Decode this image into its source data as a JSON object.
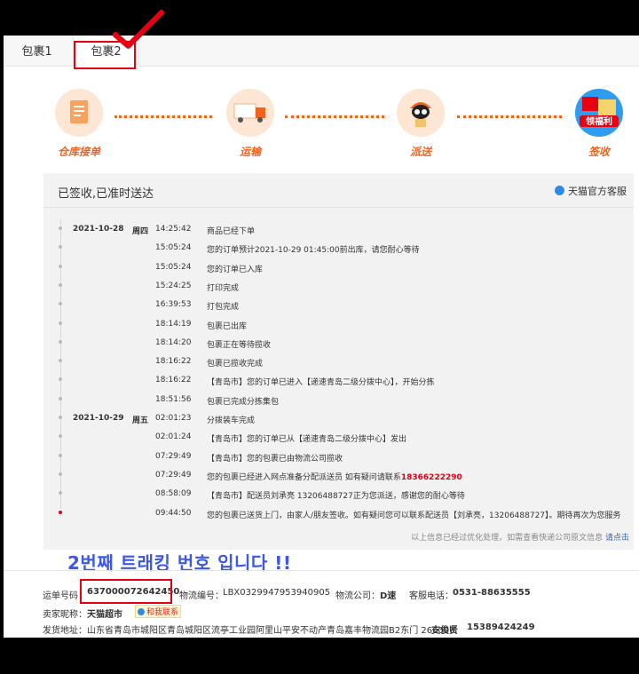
{
  "tabs": [
    {
      "label": "包裹1"
    },
    {
      "label": "包裹2"
    }
  ],
  "steps": [
    {
      "label": "仓库接单",
      "icon": "warehouse-icon"
    },
    {
      "label": "运输",
      "icon": "truck-icon"
    },
    {
      "label": "派送",
      "icon": "courier-icon"
    },
    {
      "label": "签收",
      "icon": "gift-icon",
      "badge": "领福利"
    }
  ],
  "tracking": {
    "status": "已签收,已准时送达",
    "service": "天猫官方客服",
    "footer_note": "以上信息已经过优化处理，如需查看快递公司原文信息",
    "footer_link": "请点击",
    "events": [
      {
        "date": "2021-10-28",
        "weekday": "周四",
        "time": "14:25:42",
        "desc": "商品已经下单"
      },
      {
        "date": "",
        "weekday": "",
        "time": "15:05:24",
        "desc": "您的订单预计2021-10-29 01:45:00前出库，请您耐心等待"
      },
      {
        "date": "",
        "weekday": "",
        "time": "15:05:24",
        "desc": "您的订单已入库"
      },
      {
        "date": "",
        "weekday": "",
        "time": "15:24:25",
        "desc": "打印完成"
      },
      {
        "date": "",
        "weekday": "",
        "time": "16:39:53",
        "desc": "打包完成"
      },
      {
        "date": "",
        "weekday": "",
        "time": "18:14:19",
        "desc": "包裹已出库"
      },
      {
        "date": "",
        "weekday": "",
        "time": "18:14:20",
        "desc": "包裹正在等待揽收"
      },
      {
        "date": "",
        "weekday": "",
        "time": "18:16:22",
        "desc": "包裹已揽收完成"
      },
      {
        "date": "",
        "weekday": "",
        "time": "18:16:22",
        "desc": "【青岛市】您的订单已进入【递速青岛二级分拨中心】，开始分拣"
      },
      {
        "date": "",
        "weekday": "",
        "time": "18:51:56",
        "desc": "包裹已完成分拣集包"
      },
      {
        "date": "2021-10-29",
        "weekday": "周五",
        "time": "02:01:23",
        "desc": "分拨装车完成"
      },
      {
        "date": "",
        "weekday": "",
        "time": "02:01:24",
        "desc": "【青岛市】您的订单已从【递速青岛二级分拨中心】发出"
      },
      {
        "date": "",
        "weekday": "",
        "time": "07:29:49",
        "desc": "【青岛市】您的包裹已由物流公司揽收"
      },
      {
        "date": "",
        "weekday": "",
        "time": "07:29:49",
        "desc": "您的包裹已经进入网点准备分配派送员 如有疑问请联系",
        "phone": "18366222290"
      },
      {
        "date": "",
        "weekday": "",
        "time": "08:58:09",
        "desc": "【青岛市】配送员刘承亮 13206488727正为您派送，感谢您的耐心等待"
      },
      {
        "date": "",
        "weekday": "",
        "time": "09:44:50",
        "desc": "您的包裹已送货上门，由家人/朋友签收。如有疑问您可以联系配送员【刘承亮，13206488727】。期待再次为您服务",
        "last": true
      }
    ]
  },
  "annotation": "2번째 트래킹 번호 입니다 !!",
  "info": {
    "waybill_label": "运单号码：",
    "waybill": "637000072642450",
    "lognum_label": "物流编号：",
    "lognum": "LBX0329947953940905",
    "company_label": "物流公司：",
    "company": "D速",
    "tel_label": "客服电话：",
    "tel": "0531-88635555",
    "seller_label": "卖家昵称：",
    "seller": "天猫超市",
    "contact": "和我联系",
    "address_label": "发货地址：",
    "address": "山东省青岛市城阳区青岛城阳区流亭工业园阿里山平安不动产青岛嘉丰物流园B2东门 266000",
    "sender": "支俊贤",
    "mobile": "15389424249"
  },
  "colors": {
    "accent": "#f5621c",
    "red": "#e60012",
    "annotation": "#3d57e6"
  }
}
